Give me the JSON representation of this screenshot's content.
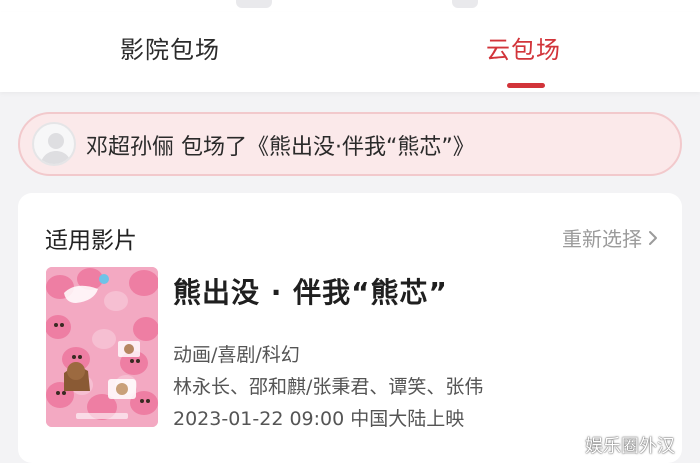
{
  "tabs": [
    {
      "label": "影院包场",
      "active": false
    },
    {
      "label": "云包场",
      "active": true
    }
  ],
  "accent_color": "#d2343a",
  "banner": {
    "text": "邓超孙俪 包场了《熊出没·伴我“熊芯”》"
  },
  "card": {
    "section_title": "适用影片",
    "reselect_label": "重新选择",
    "movie": {
      "title": "熊出没 · 伴我“熊芯”",
      "genre": "动画/喜剧/科幻",
      "cast": "林永长、邵和麒/张秉君、谭笑、张伟",
      "release": "2023-01-22 09:00 中国大陆上映"
    }
  },
  "watermark": "娱乐圈外汉"
}
